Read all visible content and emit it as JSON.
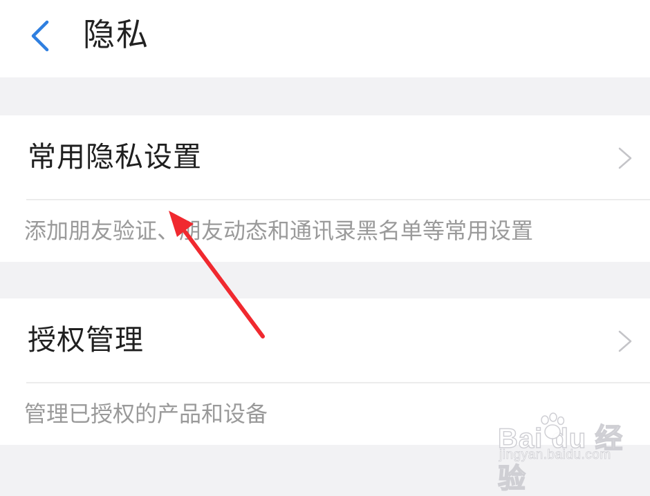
{
  "header": {
    "title": "隐私",
    "back_icon": "chevron-left-icon"
  },
  "sections": [
    {
      "label": "常用隐私设置",
      "description": "添加朋友验证、朋友动态和通讯录黑名单等常用设置",
      "icon": "chevron-right-icon"
    },
    {
      "label": "授权管理",
      "description": "管理已授权的产品和设备",
      "icon": "chevron-right-icon"
    }
  ],
  "watermark": {
    "brand": "Bai du 经验",
    "site": "jingyan.baidu.com"
  },
  "colors": {
    "accent": "#2f7fe0",
    "arrow": "#f0292f",
    "background": "#f2f2f4"
  }
}
